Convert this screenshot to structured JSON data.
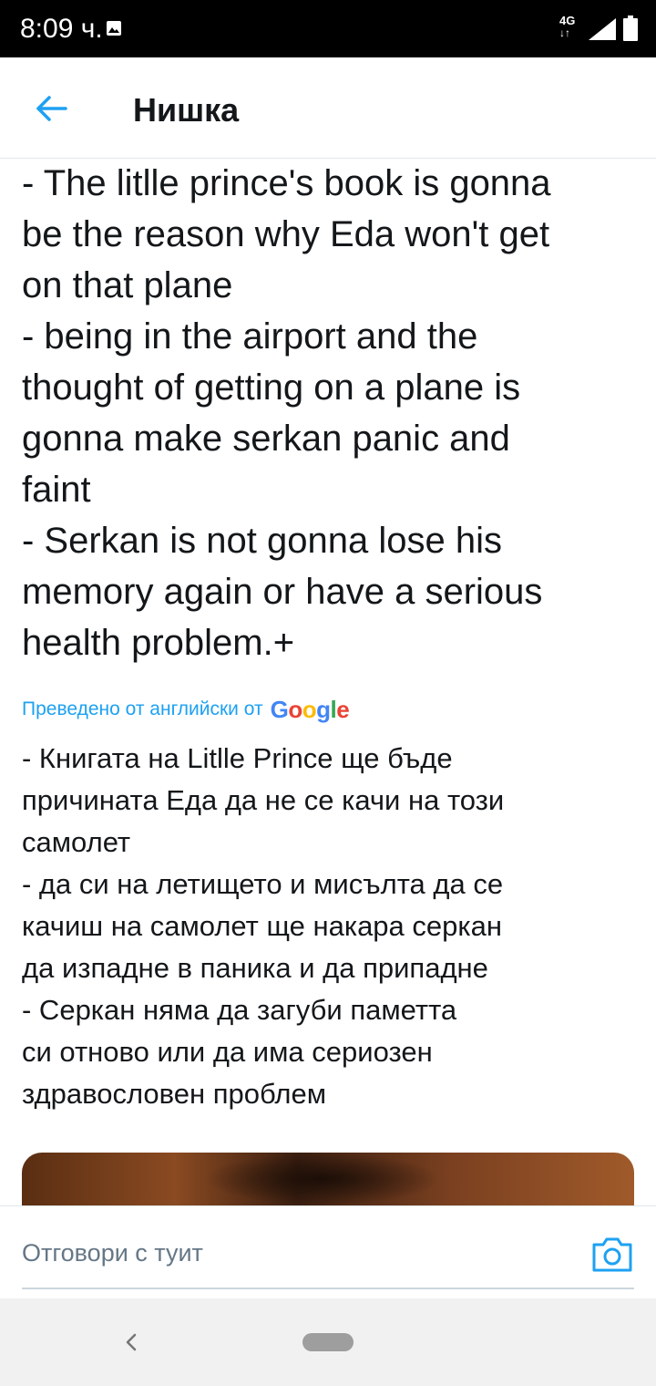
{
  "status_bar": {
    "time": "8:09 ч.",
    "network": "4G",
    "network_arrows": "↓↑"
  },
  "header": {
    "title": "Нишка",
    "back_icon": "arrow-left-icon"
  },
  "tweet": {
    "text": "- The litlle prince's book is gonna\nbe the reason why Eda won't get\non that plane\n- being in the airport and the\nthought of getting on a plane is\ngonna make serkan panic and\nfaint\n- Serkan is not gonna lose his\nmemory again or have a serious\nhealth problem.+",
    "translation_label": "Преведено от английски от",
    "translation_provider": "Google",
    "translated_text": "- Книгата на Litlle Prince ще бъде\nпричината Еда да не се качи на този\nсамолет\n - да си на летището и мисълта да се\nкачиш на самолет ще накара серкан\nда изпадне в паника и да припадне\n - Серкан няма да загуби паметта\nси отново или да има сериозен\nздравословен проблем"
  },
  "reply": {
    "placeholder": "Отговори с туит",
    "camera_icon": "camera-icon"
  },
  "colors": {
    "accent": "#1da1f2",
    "text": "#14171a",
    "secondary_text": "#657786",
    "google_blue": "#4285f4",
    "google_red": "#ea4335",
    "google_yellow": "#fbbc05",
    "google_green": "#34a853"
  }
}
